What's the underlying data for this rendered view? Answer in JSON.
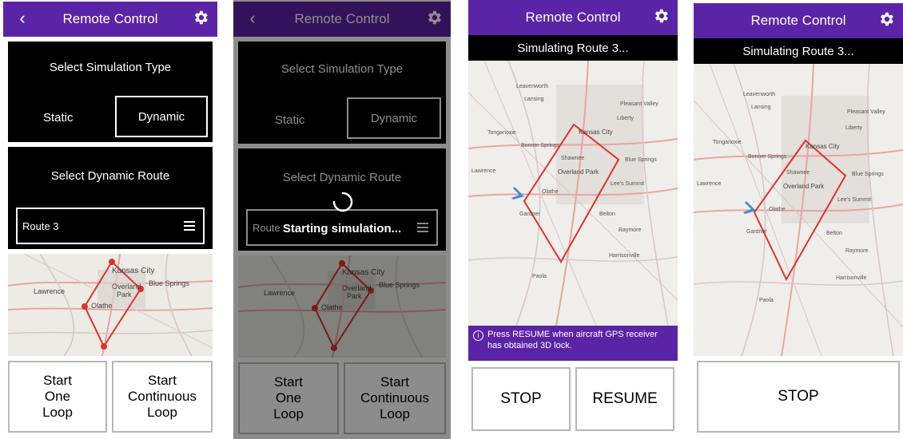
{
  "colors": {
    "header": "#5b24a6",
    "route": "#e0322b",
    "aircraft": "#3d8fd8"
  },
  "screen1": {
    "header": {
      "title": "Remote Control",
      "back_icon": "chevron-left-icon",
      "settings_icon": "gear-icon"
    },
    "sim_type": {
      "label": "Select Simulation Type",
      "static": "Static",
      "dynamic": "Dynamic",
      "selected": "Dynamic"
    },
    "route": {
      "label": "Select Dynamic Route",
      "value": "Route 3",
      "menu_icon": "hamburger-icon"
    },
    "map": {
      "labels": [
        "Kansas City",
        "Overland",
        "Park",
        "Blue Springs",
        "Lawrence",
        "Olathe"
      ]
    },
    "buttons": {
      "one_loop": "Start\nOne\nLoop",
      "continuous": "Start\nContinuous\nLoop"
    }
  },
  "screen2": {
    "header": {
      "title": "Remote Control"
    },
    "sim_type": {
      "label": "Select Simulation Type",
      "static": "Static",
      "dynamic": "Dynamic"
    },
    "route": {
      "label": "Select Dynamic Route",
      "value": "Route"
    },
    "loading": "Starting simulation...",
    "map": {
      "labels": [
        "Kansas City",
        "Overland",
        "Park",
        "Blue Springs",
        "Lawrence",
        "Olathe"
      ]
    },
    "buttons": {
      "one_loop": "Start\nOne\nLoop",
      "continuous": "Start\nContinuous\nLoop"
    }
  },
  "screen3": {
    "header": {
      "title": "Remote Control"
    },
    "status": "Simulating Route 3...",
    "map": {
      "labels": [
        "Leavenworth",
        "Kansas City",
        "Liberty",
        "Shawnee",
        "Overland Park",
        "Blue Springs",
        "Lee's Summit",
        "Olathe",
        "Lawrence",
        "Gardner",
        "Belton",
        "Harrisonville",
        "Paola",
        "Tonganoxie",
        "Pleasant Valley",
        "Bonner Springs",
        "Lansing",
        "Raymore"
      ]
    },
    "notice": "Press RESUME when aircraft GPS receiver has obtained 3D lock.",
    "buttons": {
      "stop": "STOP",
      "resume": "RESUME"
    }
  },
  "screen4": {
    "header": {
      "title": "Remote Control"
    },
    "status": "Simulating Route 3...",
    "map": {
      "labels": [
        "Leavenworth",
        "Kansas City",
        "Liberty",
        "Shawnee",
        "Overland Park",
        "Blue Springs",
        "Lee's Summit",
        "Olathe",
        "Lawrence",
        "Gardner",
        "Belton",
        "Harrisonville",
        "Paola",
        "Tonganoxie",
        "Pleasant Valley",
        "Bonner Springs",
        "Lansing",
        "Raymore"
      ]
    },
    "buttons": {
      "stop": "STOP"
    }
  }
}
